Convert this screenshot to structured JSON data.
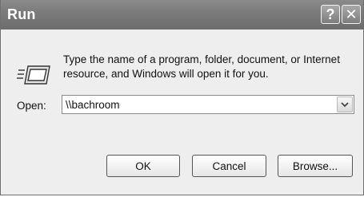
{
  "window": {
    "title": "Run",
    "help_glyph": "?",
    "close_glyph": "✕"
  },
  "dialog": {
    "description": "Type the name of a program, folder, document, or Internet resource, and Windows will open it for you.",
    "icon": "run-icon"
  },
  "open_field": {
    "label": "Open:",
    "value": "\\\\bachroom",
    "dropdown_icon": "chevron-down-icon"
  },
  "buttons": {
    "ok": "OK",
    "cancel": "Cancel",
    "browse": "Browse..."
  }
}
